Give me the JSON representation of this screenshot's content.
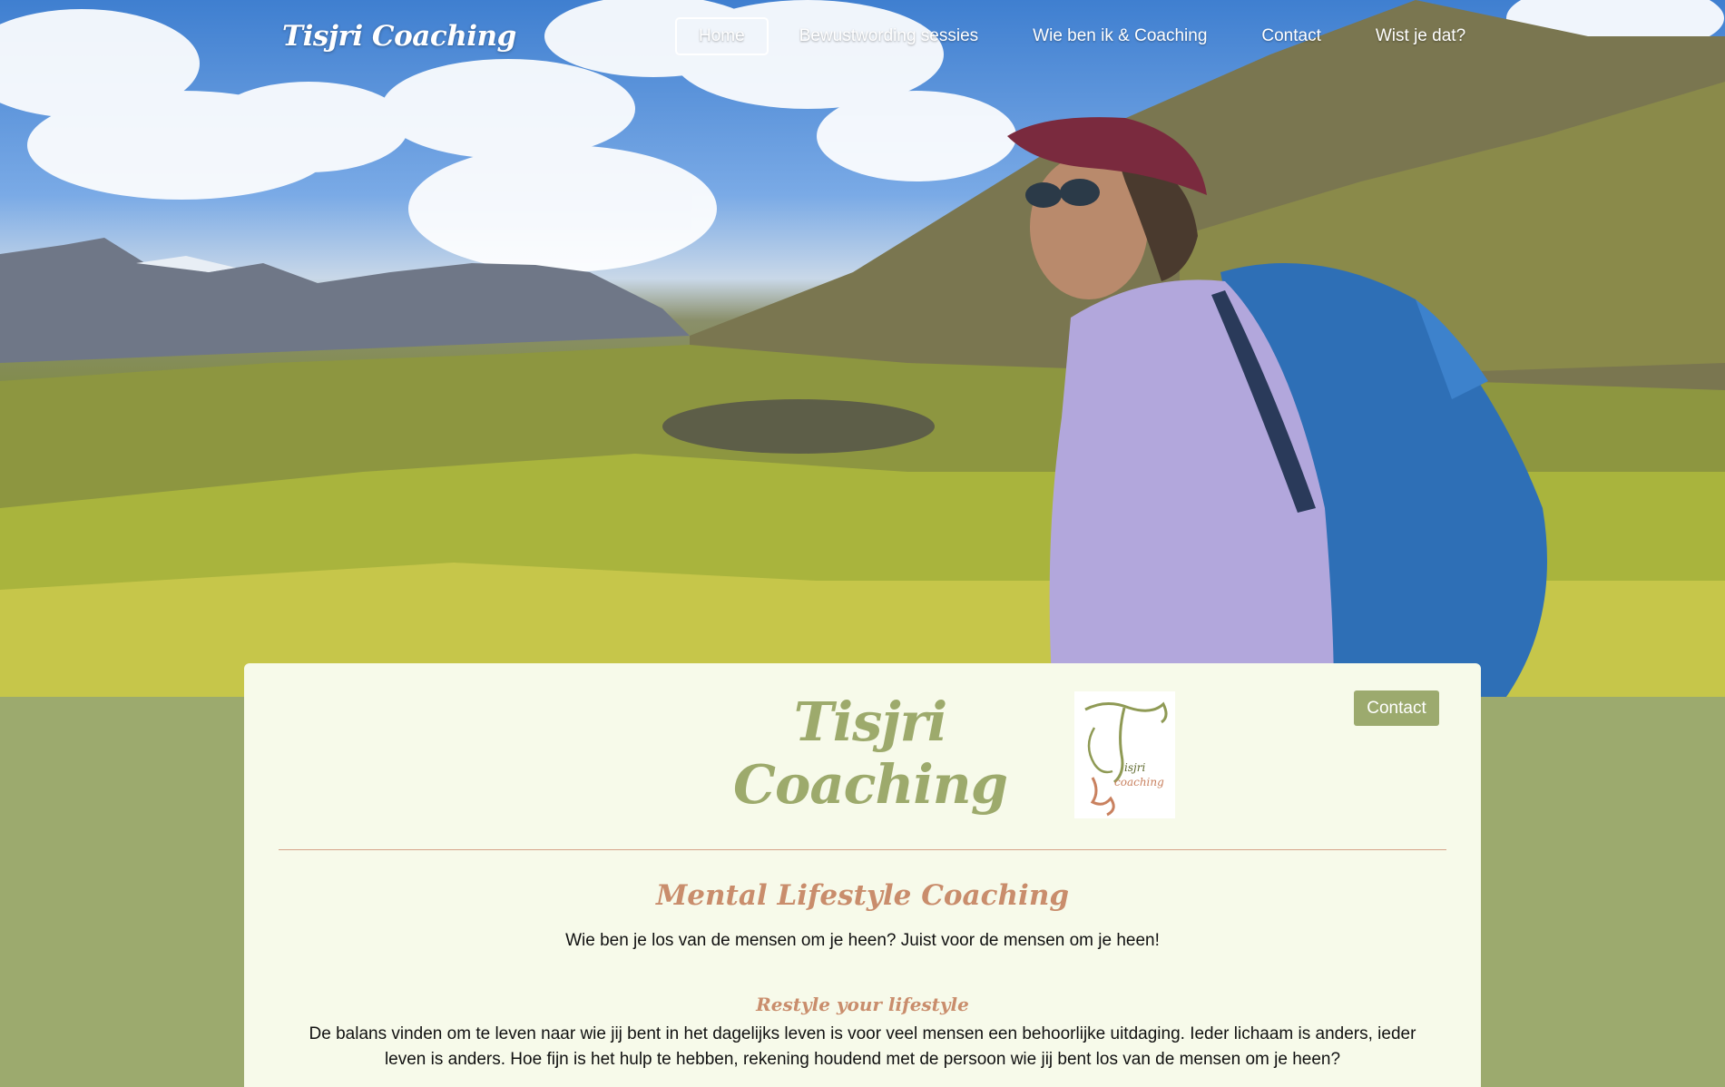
{
  "header": {
    "logo_text": "Tisjri Coaching",
    "nav": [
      {
        "label": "Home",
        "active": true
      },
      {
        "label": "Bewustwording sessies"
      },
      {
        "label": "Wie ben ik & Coaching"
      },
      {
        "label": "Contact"
      },
      {
        "label": "Wist je dat?"
      }
    ]
  },
  "card": {
    "title": "Tisjri Coaching",
    "logo_text_top": "isjri",
    "logo_text_bottom": "coaching",
    "contact_button": "Contact",
    "section_heading": "Mental Lifestyle Coaching",
    "section_subtitle": "Wie ben je los van de mensen om je heen? Juist voor de mensen om je heen!",
    "sub_heading": "Restyle your lifestyle",
    "body": "De balans vinden om te leven naar wie jij bent in het dagelijks leven is voor veel mensen een behoorlijke uitdaging. Ieder lichaam is anders, ieder leven is anders. Hoe fijn is het hulp te hebben, rekening houdend met de persoon wie jij bent los van de mensen om je heen?"
  },
  "colors": {
    "accent_green": "#9caa6e",
    "accent_terracotta": "#c98d6c",
    "card_bg": "#f7faea"
  },
  "icons": {
    "hero_image": "mountain-hiker-photo",
    "brand_logo": "tisjri-coaching-logo"
  }
}
